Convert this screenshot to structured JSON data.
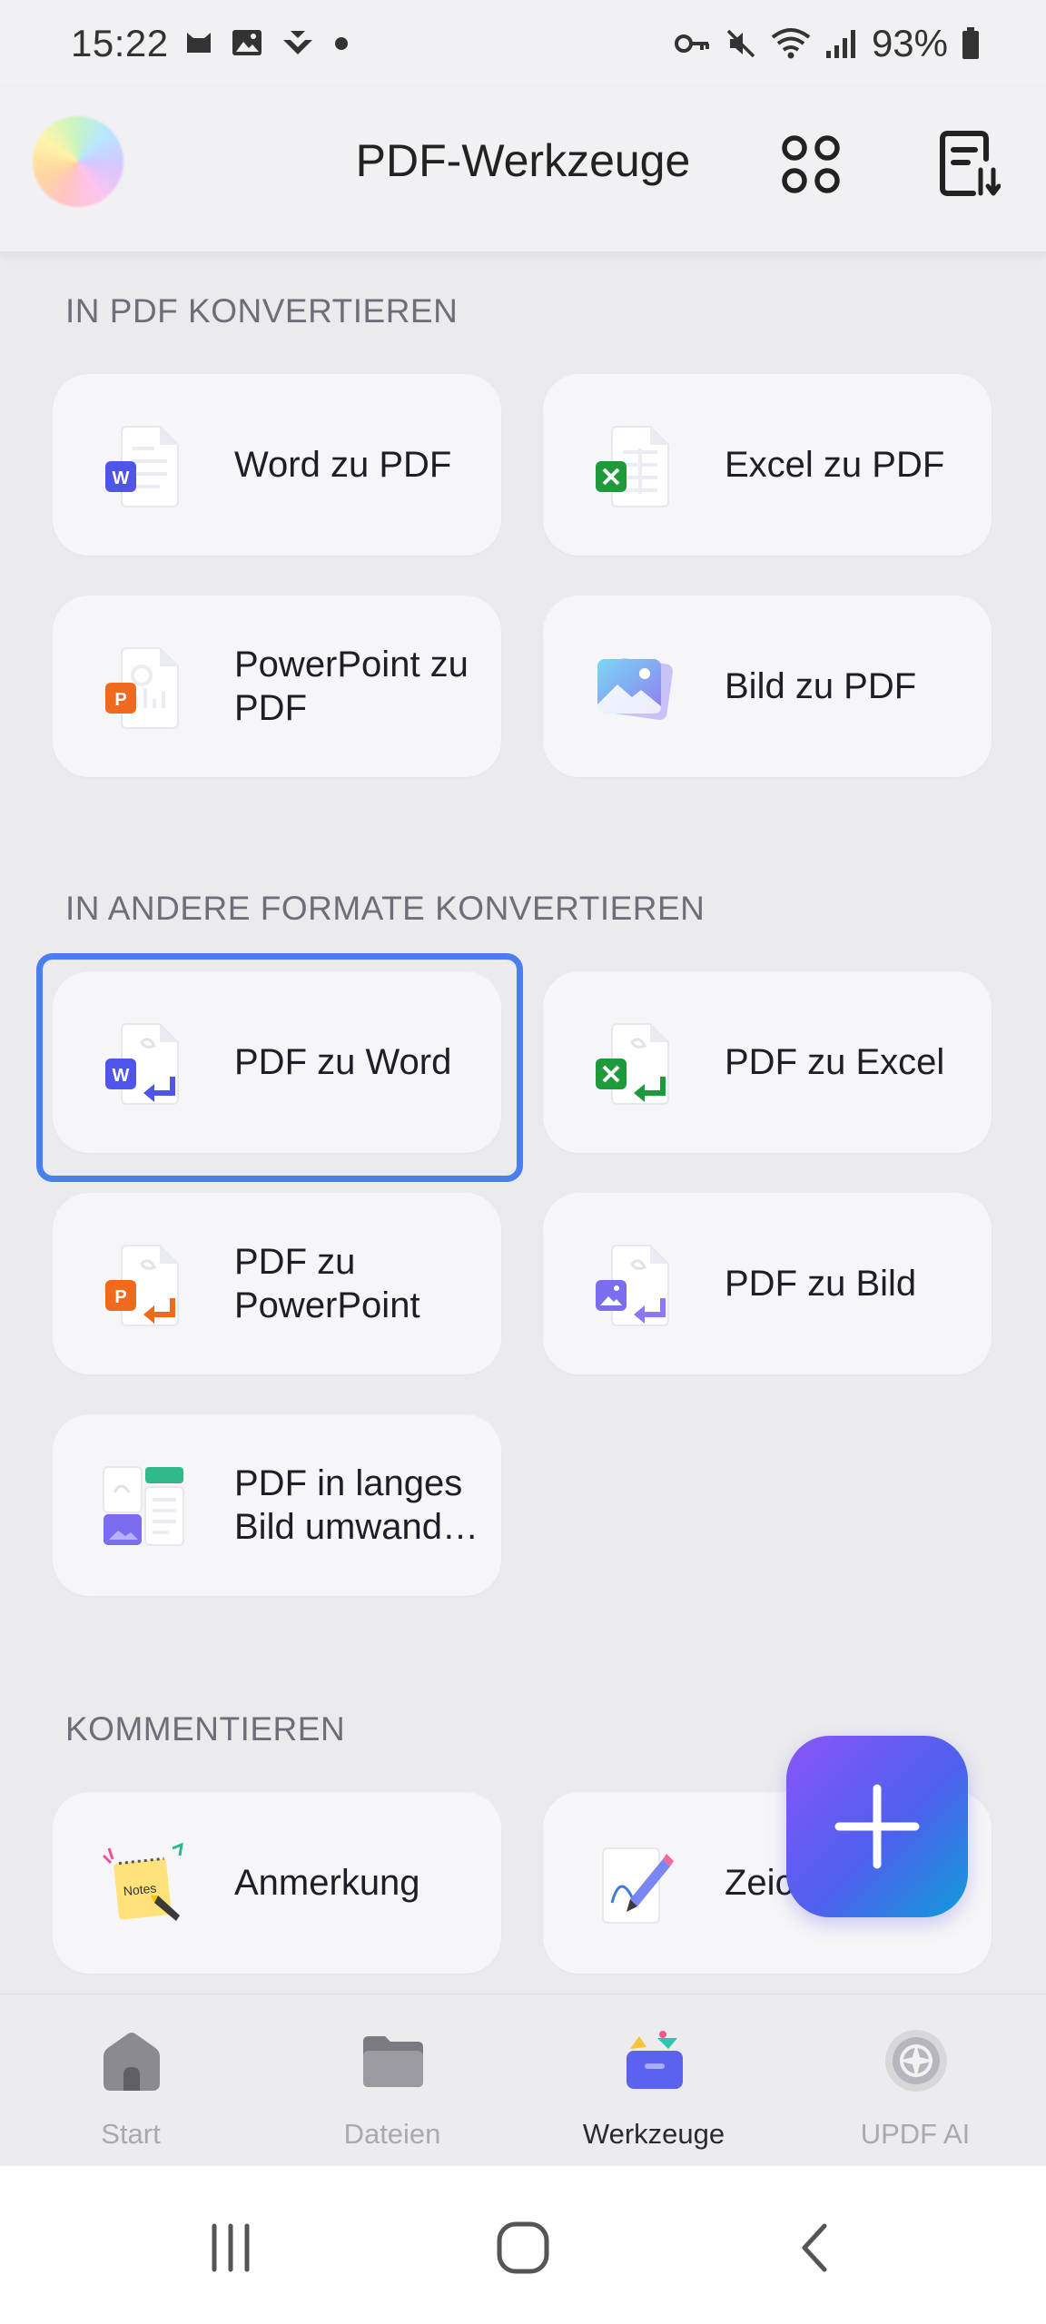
{
  "status": {
    "time": "15:22",
    "battery": "93%"
  },
  "header": {
    "title": "PDF-Werkzeuge"
  },
  "sections": {
    "to_pdf": {
      "title": "IN PDF KONVERTIEREN",
      "items": [
        {
          "label": "Word zu PDF",
          "icon": "word-doc-icon"
        },
        {
          "label": "Excel zu PDF",
          "icon": "excel-doc-icon"
        },
        {
          "label": "PowerPoint zu PDF",
          "icon": "powerpoint-doc-icon"
        },
        {
          "label": "Bild zu PDF",
          "icon": "image-stack-icon"
        }
      ]
    },
    "from_pdf": {
      "title": "IN ANDERE FORMATE KONVERTIEREN",
      "items": [
        {
          "label": "PDF zu Word",
          "icon": "pdf-to-word-icon"
        },
        {
          "label": "PDF zu Excel",
          "icon": "pdf-to-excel-icon"
        },
        {
          "label": "PDF zu PowerPoint",
          "icon": "pdf-to-powerpoint-icon"
        },
        {
          "label": "PDF zu Bild",
          "icon": "pdf-to-image-icon"
        },
        {
          "label": "PDF in langes Bild umwand…",
          "icon": "long-image-icon"
        }
      ]
    },
    "comment": {
      "title": "KOMMENTIEREN",
      "items": [
        {
          "label": "Anmerkung",
          "icon": "sticky-note-icon"
        },
        {
          "label": "Zeic",
          "icon": "signature-pen-icon"
        }
      ]
    }
  },
  "nav": {
    "items": [
      {
        "label": "Start",
        "icon": "home-icon"
      },
      {
        "label": "Dateien",
        "icon": "folder-icon"
      },
      {
        "label": "Werkzeuge",
        "icon": "toolbox-icon",
        "active": true
      },
      {
        "label": "UPDF AI",
        "icon": "ai-icon"
      }
    ]
  },
  "colors": {
    "accent_outline": "#4a7ded",
    "word": "#4f55e8",
    "excel": "#1f9a3a",
    "powerpoint": "#f06a1e",
    "image": "#7b6cf0"
  }
}
